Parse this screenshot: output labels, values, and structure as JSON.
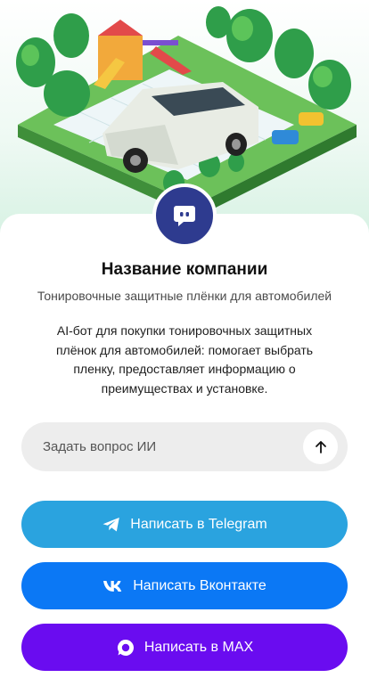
{
  "hero": {
    "illustration": "isometric park with white SUV, trees and playground"
  },
  "avatar": {
    "icon": "chat-bubble-icon",
    "color": "#2e3b8f"
  },
  "company": {
    "name": "Название компании",
    "tagline": "Тонировочные защитные плёнки для автомобилей",
    "description": "AI-бот для покупки тонировочных защитных плёнок для автомобилей: помогает выбрать пленку, предоставляет информацию о преимуществах и установке."
  },
  "ask": {
    "placeholder": "Задать вопрос ИИ",
    "send_icon": "arrow-up-icon"
  },
  "buttons": {
    "telegram": {
      "label": "Написать в Telegram",
      "icon": "telegram-icon",
      "color": "#2aa3df"
    },
    "vk": {
      "label": "Написать Вконтакте",
      "icon": "vk-icon",
      "color": "#0b78f5"
    },
    "max": {
      "label": "Написать в MAX",
      "icon": "max-icon",
      "color": "#6a0cf0"
    }
  }
}
